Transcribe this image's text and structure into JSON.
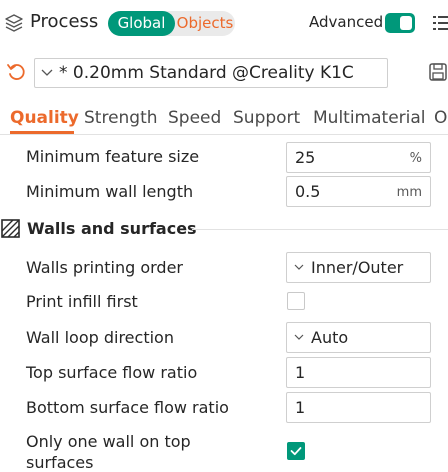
{
  "header": {
    "title": "Process",
    "seg_global": "Global",
    "seg_objects": "Objects",
    "advanced_label": "Advanced",
    "advanced_on": true
  },
  "preset": {
    "name": "* 0.20mm Standard @Creality K1C"
  },
  "tabs": [
    {
      "label": "Quality",
      "active": true
    },
    {
      "label": "Strength"
    },
    {
      "label": "Speed"
    },
    {
      "label": "Support"
    },
    {
      "label": "Multimaterial"
    },
    {
      "label": "O"
    }
  ],
  "quality": {
    "min_feature_size": {
      "label": "Minimum feature size",
      "value": "25",
      "unit": "%"
    },
    "min_wall_length": {
      "label": "Minimum wall length",
      "value": "0.5",
      "unit": "mm"
    }
  },
  "walls": {
    "section_title": "Walls and surfaces",
    "walls_printing_order": {
      "label": "Walls printing order",
      "value": "Inner/Outer"
    },
    "print_infill_first": {
      "label": "Print infill first",
      "checked": false
    },
    "wall_loop_direction": {
      "label": "Wall loop direction",
      "value": "Auto"
    },
    "top_surface_flow_ratio": {
      "label": "Top surface flow ratio",
      "value": "1"
    },
    "bottom_surface_flow_ratio": {
      "label": "Bottom surface flow ratio",
      "value": "1"
    },
    "only_one_wall_top": {
      "label_line1": "Only one wall on top",
      "label_line2": "surfaces",
      "checked": true
    }
  },
  "colors": {
    "accent_green": "#00987a",
    "accent_orange": "#ec6a2c"
  }
}
